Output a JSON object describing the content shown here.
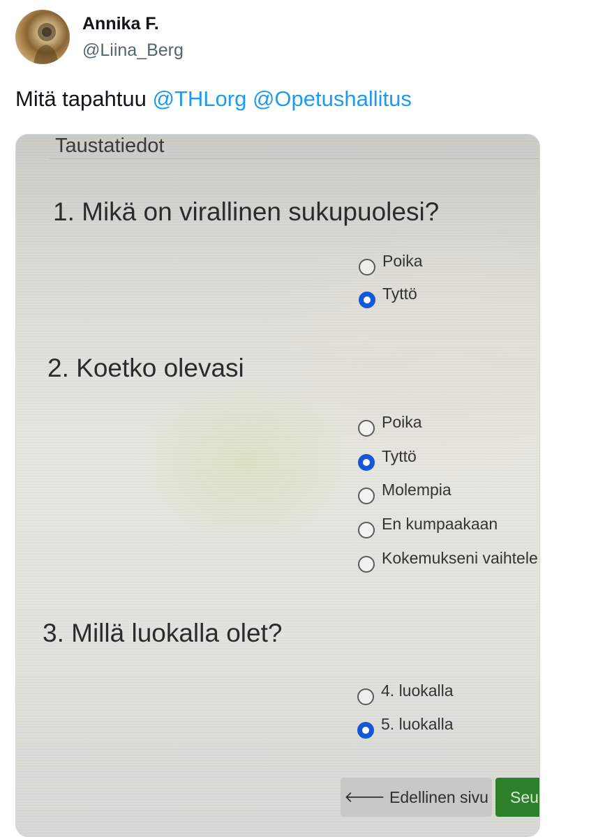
{
  "tweet": {
    "author_name": "Annika F.",
    "author_handle": "@Liina_Berg",
    "text_prefix": "Mitä tapahtuu ",
    "mentions": [
      "@THLorg",
      "@Opetushallitus"
    ]
  },
  "form": {
    "section_title": "Taustatiedot",
    "questions": [
      {
        "title": "1. Mikä on virallinen sukupuolesi?",
        "options": [
          {
            "label": "Poika",
            "selected": false
          },
          {
            "label": "Tyttö",
            "selected": true
          }
        ]
      },
      {
        "title": "2. Koetko olevasi",
        "options": [
          {
            "label": "Poika",
            "selected": false
          },
          {
            "label": "Tyttö",
            "selected": true
          },
          {
            "label": "Molempia",
            "selected": false
          },
          {
            "label": "En kumpaakaan",
            "selected": false
          },
          {
            "label": "Kokemukseni vaihtele",
            "selected": false
          }
        ]
      },
      {
        "title": "3. Millä luokalla olet?",
        "options": [
          {
            "label": "4. luokalla",
            "selected": false
          },
          {
            "label": "5. luokalla",
            "selected": true
          }
        ]
      }
    ],
    "prev_button": {
      "icon": "arrow-left-icon",
      "label": "Edellinen sivu"
    },
    "next_button": {
      "label": "Seu"
    }
  },
  "colors": {
    "mention": "#1d9bf0",
    "radio_selected": "#1457d8",
    "next_button": "#2e7f2a"
  }
}
